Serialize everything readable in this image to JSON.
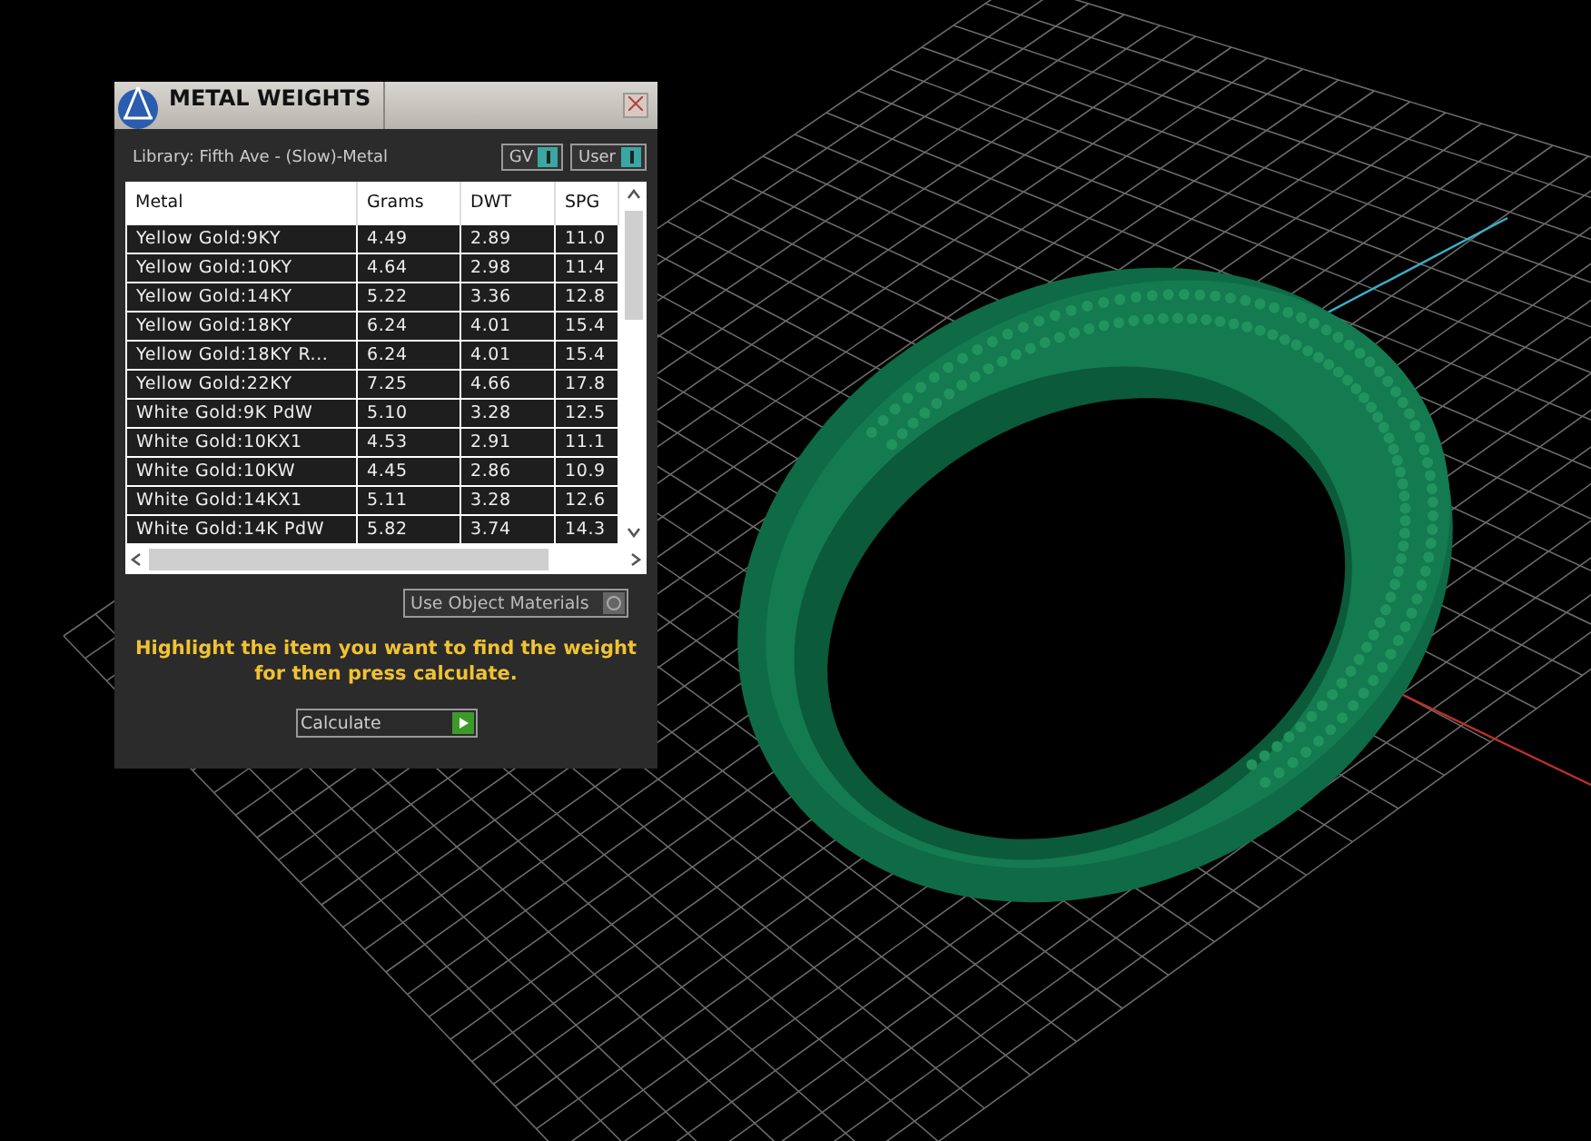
{
  "window": {
    "title": "METAL WEIGHTS"
  },
  "library": "Library: Fifth Ave - (Slow)-Metal",
  "toggles": [
    {
      "label": "GV",
      "on": true
    },
    {
      "label": "User",
      "on": true
    }
  ],
  "table": {
    "columns": [
      "Metal",
      "Grams",
      "DWT",
      "SPG"
    ],
    "rows": [
      [
        "Yellow Gold:9KY",
        "4.49",
        "2.89",
        "11.0"
      ],
      [
        "Yellow Gold:10KY",
        "4.64",
        "2.98",
        "11.4"
      ],
      [
        "Yellow Gold:14KY",
        "5.22",
        "3.36",
        "12.8"
      ],
      [
        "Yellow Gold:18KY",
        "6.24",
        "4.01",
        "15.4"
      ],
      [
        "Yellow Gold:18KY R...",
        "6.24",
        "4.01",
        "15.4"
      ],
      [
        "Yellow Gold:22KY",
        "7.25",
        "4.66",
        "17.8"
      ],
      [
        "White Gold:9K PdW",
        "5.10",
        "3.28",
        "12.5"
      ],
      [
        "White Gold:10KX1",
        "4.53",
        "2.91",
        "11.1"
      ],
      [
        "White Gold:10KW",
        "4.45",
        "2.86",
        "10.9"
      ],
      [
        "White Gold:14KX1",
        "5.11",
        "3.28",
        "12.6"
      ],
      [
        "White Gold:14K PdW",
        "5.82",
        "3.74",
        "14.3"
      ]
    ]
  },
  "use_object_materials": {
    "label": "Use Object Materials",
    "on": false
  },
  "hint": "Highlight the item you want to find the weight for then press calculate.",
  "calculate_button": "Calculate"
}
